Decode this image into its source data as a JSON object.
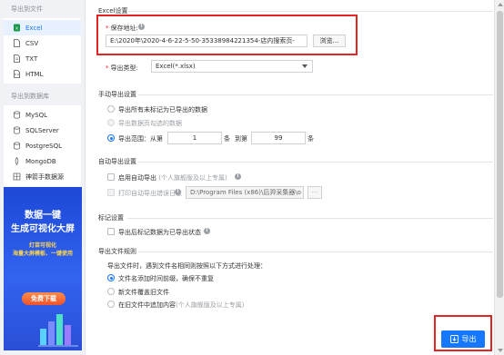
{
  "sidebar": {
    "file_group_title": "导出到文件",
    "file_items": [
      {
        "label": "Excel",
        "icon": "excel-file-icon"
      },
      {
        "label": "CSV",
        "icon": "csv-file-icon"
      },
      {
        "label": "TXT",
        "icon": "txt-file-icon"
      },
      {
        "label": "HTML",
        "icon": "html-file-icon"
      }
    ],
    "db_group_title": "导出到数据库",
    "db_items": [
      {
        "label": "MySQL",
        "icon": "mysql-icon"
      },
      {
        "label": "SQLServer",
        "icon": "sqlserver-icon"
      },
      {
        "label": "PostgreSQL",
        "icon": "postgresql-icon"
      },
      {
        "label": "MongoDB",
        "icon": "mongodb-icon"
      },
      {
        "label": "神箭手数据源",
        "icon": "datasource-icon"
      }
    ],
    "active_item": "Excel"
  },
  "ad": {
    "title_line1": "数据一键",
    "title_line2": "生成可视化大屏",
    "sub_line1": "灯苗可视化",
    "sub_line2": "海量大屏模板、一键使用",
    "button": "免费下载"
  },
  "excel_settings": {
    "section_title": "Excel设置",
    "save_path_label": "保存地址:",
    "save_path_value": "E:\\2020年\\2020-4-6-22-5-50-35338984221354-店内搜索页-",
    "browse_button": "浏览...",
    "export_type_label": "导出类型:",
    "export_type_value": "Excel(*.xlsx)"
  },
  "manual_export": {
    "section_title": "手动导出设置",
    "option_all": "导出所有未标记为已导出的数据",
    "option_current_page": "导出数据页勾选的数据",
    "option_range": "导出范围：从第",
    "range_from": "1",
    "range_unit1": "条",
    "range_to_label": "到第",
    "range_to": "99",
    "range_unit2": "条",
    "selected": "range"
  },
  "auto_export": {
    "section_title": "自动导出设置",
    "enable_label": "启用自动导出",
    "enable_note": "(个人旗舰版及以上专属)",
    "log_label": "打印自动导出错误日志",
    "log_path": "D:\\Program Files (x86)\\后羿采集器\\o",
    "log_browse": "···"
  },
  "mark_settings": {
    "section_title": "标记设置",
    "mark_label": "导出后标记数据为已导出状态"
  },
  "export_rules": {
    "section_title": "导出文件规则",
    "description": "导出文件时，遇到文件名相同则按照以下方式进行处理：",
    "option_timestamp": "文件名添加时间前缀，确保不重复",
    "option_overwrite": "新文件覆盖旧文件",
    "option_append": "在旧文件中追加内容",
    "option_append_note": "(个人旗舰版及以上专属)",
    "selected": "timestamp"
  },
  "footer": {
    "export_button": "导出",
    "export_icon": "export-icon"
  },
  "colors": {
    "accent": "#1677ff",
    "highlight_box": "#e32424",
    "ad_blue": "#2a55e6"
  }
}
